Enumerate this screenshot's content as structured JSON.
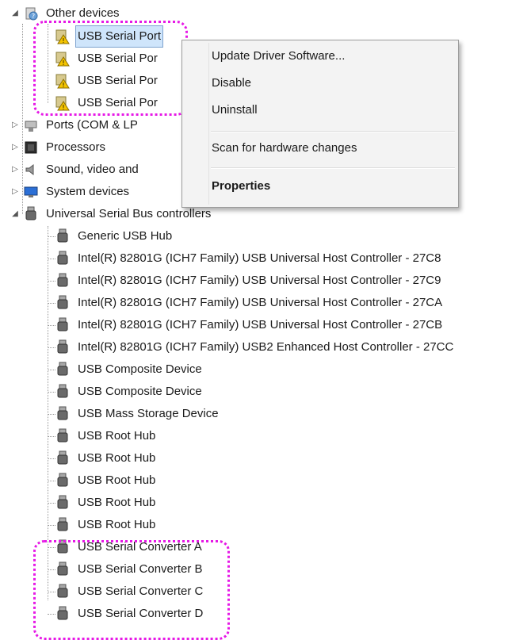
{
  "tree": {
    "other_devices": {
      "label": "Other devices",
      "children": [
        "USB Serial Port",
        "USB Serial Por",
        "USB Serial Por",
        "USB Serial Por"
      ]
    },
    "ports": "Ports (COM & LP",
    "processors": "Processors",
    "sound": "Sound, video and",
    "system_devices": "System devices",
    "usb_controllers": {
      "label": "Universal Serial Bus controllers",
      "children": [
        "Generic USB Hub",
        "Intel(R) 82801G (ICH7 Family) USB Universal Host Controller - 27C8",
        "Intel(R) 82801G (ICH7 Family) USB Universal Host Controller - 27C9",
        "Intel(R) 82801G (ICH7 Family) USB Universal Host Controller - 27CA",
        "Intel(R) 82801G (ICH7 Family) USB Universal Host Controller - 27CB",
        "Intel(R) 82801G (ICH7 Family) USB2 Enhanced Host Controller - 27CC",
        "USB Composite Device",
        "USB Composite Device",
        "USB Mass Storage Device",
        "USB Root Hub",
        "USB Root Hub",
        "USB Root Hub",
        "USB Root Hub",
        "USB Root Hub",
        "USB Serial Converter A",
        "USB Serial Converter B",
        "USB Serial Converter C",
        "USB Serial Converter D"
      ]
    }
  },
  "context_menu": {
    "update_driver": "Update Driver Software...",
    "disable": "Disable",
    "uninstall": "Uninstall",
    "scan": "Scan for hardware changes",
    "properties": "Properties"
  },
  "icons": {
    "warning": "warning-device-icon",
    "usb": "usb-plug-icon",
    "ports": "port-icon",
    "processor": "chip-icon",
    "sound": "speaker-icon",
    "system": "computer-icon"
  },
  "colors": {
    "highlight_border": "#e619e6",
    "selection_fill": "#cfe5fb",
    "warning_yellow": "#f4c400"
  }
}
